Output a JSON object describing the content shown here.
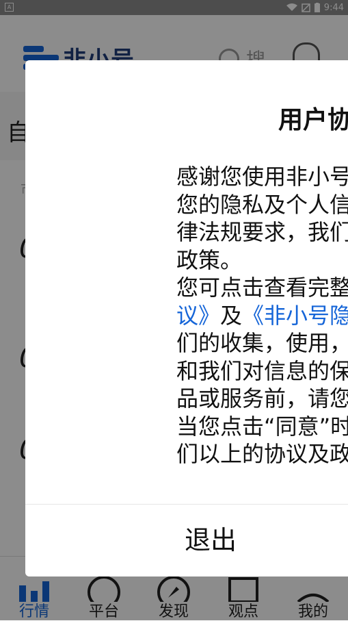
{
  "status_bar": {
    "app_badge": "A",
    "time": "9:44"
  },
  "app": {
    "logo_text": "非小号",
    "search_placeholder": "搜...",
    "tab_first": "自",
    "list_hint": "市",
    "rows": [
      "0",
      "0",
      "0"
    ],
    "bottom_nav": [
      {
        "label": "行情",
        "icon": "chart-icon",
        "active": true
      },
      {
        "label": "平台",
        "icon": "platform-icon",
        "active": false
      },
      {
        "label": "发现",
        "icon": "compass-icon",
        "active": false
      },
      {
        "label": "观点",
        "icon": "message-icon",
        "active": false
      },
      {
        "label": "我的",
        "icon": "profile-icon",
        "active": false
      }
    ]
  },
  "dialog": {
    "title": "用户协",
    "body_lines": [
      "感谢您使用非小号",
      "您的隐私及个人信",
      "律法规要求，我们",
      "政策。",
      "您可点击查看完整",
      "议》",
      "们的收集，使用，",
      "和我们对信息的保",
      "品或服务前，请您",
      "当您点击“同意”时",
      "们以上的协议及政"
    ],
    "body_line6_mid": "及",
    "body_line6_link": "《非小号隐",
    "exit_button": "退出"
  },
  "colors": {
    "accent": "#1565d8",
    "scrim": "rgba(0,0,0,0.45)"
  }
}
